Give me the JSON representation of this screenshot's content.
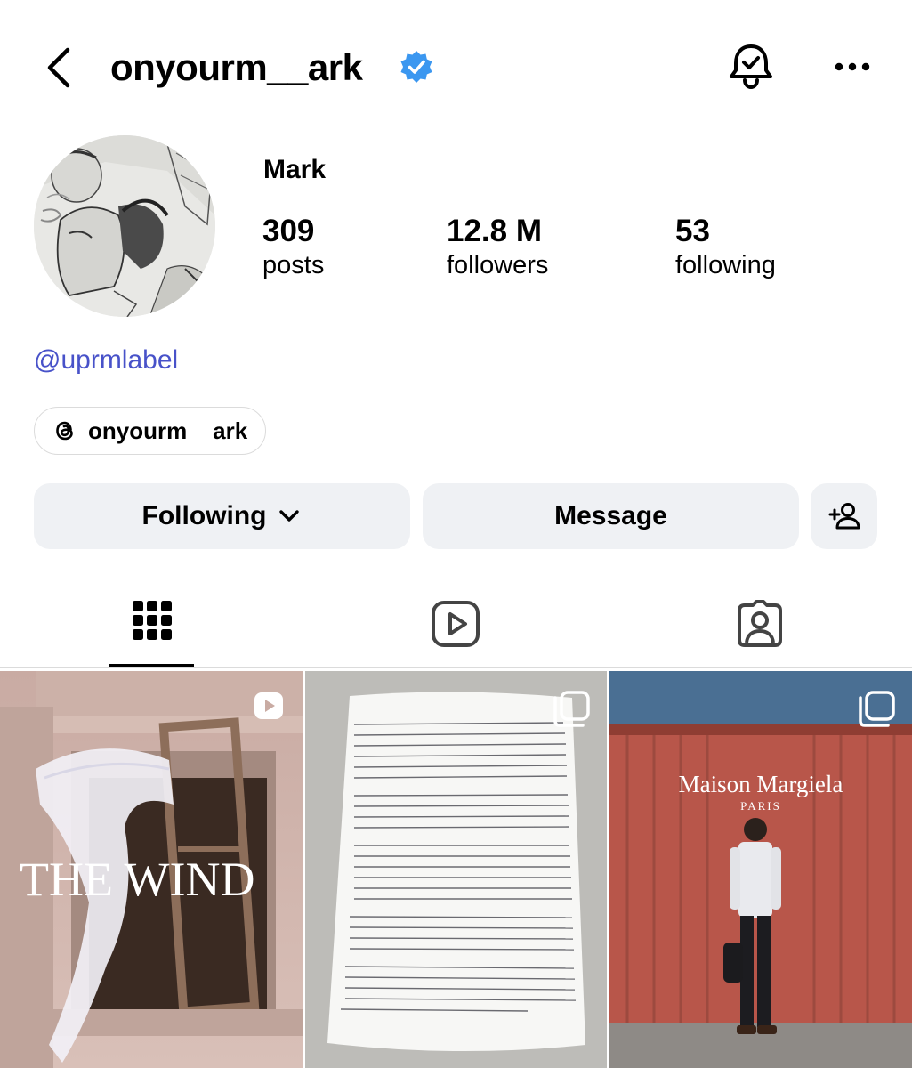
{
  "header": {
    "username": "onyourm__ark",
    "verified": true,
    "icons": [
      "back-arrow-icon",
      "verified-badge-icon",
      "notification-bell-icon",
      "more-options-icon"
    ]
  },
  "profile": {
    "display_name": "Mark",
    "stats": [
      {
        "value": "309",
        "label": "posts"
      },
      {
        "value": "12.8 M",
        "label": "followers"
      },
      {
        "value": "53",
        "label": "following"
      }
    ],
    "link": "@uprmlabel",
    "threads_handle": "onyourm__ark"
  },
  "actions": {
    "following_label": "Following",
    "message_label": "Message"
  },
  "tabs": [
    {
      "name": "posts-grid",
      "icon": "grid-icon",
      "active": true
    },
    {
      "name": "reels",
      "icon": "reels-icon",
      "active": false
    },
    {
      "name": "tagged",
      "icon": "tagged-icon",
      "active": false
    }
  ],
  "posts": [
    {
      "type": "reel",
      "overlay_text": "THE WIND"
    },
    {
      "type": "carousel",
      "overlay_text": ""
    },
    {
      "type": "carousel",
      "overlay_text": "Maison Margiela",
      "overlay_subtext": "PARIS"
    }
  ],
  "colors": {
    "verified": "#3b97f0",
    "link": "#4852c9",
    "button_bg": "#eff1f4",
    "container_red": "#b8564a"
  }
}
